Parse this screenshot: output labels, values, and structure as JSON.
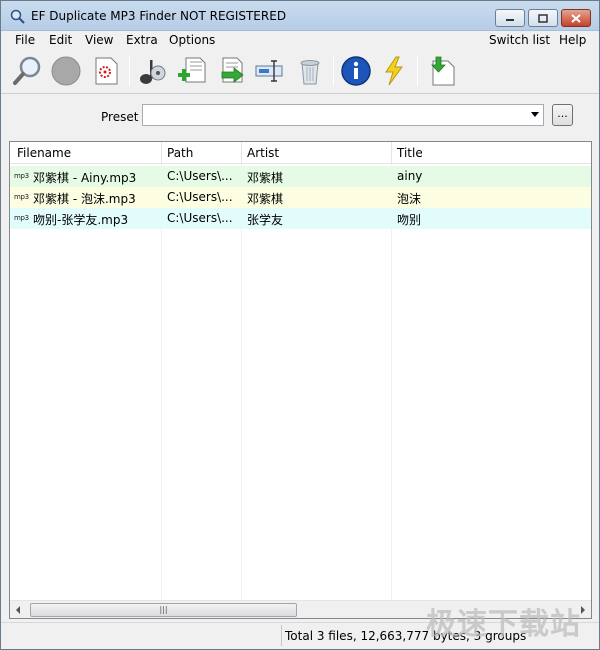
{
  "window": {
    "title": "EF Duplicate MP3 Finder NOT REGISTERED"
  },
  "menu": {
    "items": [
      "File",
      "Edit",
      "View",
      "Extra",
      "Options"
    ],
    "right_items": [
      "Switch list",
      "Help"
    ]
  },
  "toolbar": {
    "buttons": [
      "search-icon",
      "stop-icon",
      "new-document-icon",
      "music-icon",
      "add-files-icon",
      "move-files-icon",
      "rename-icon",
      "recycle-bin-icon",
      "info-icon",
      "lightning-icon",
      "download-icon"
    ]
  },
  "preset": {
    "label": "Preset",
    "value": "",
    "browse_label": "..."
  },
  "list": {
    "columns": [
      "Filename",
      "Path",
      "Artist",
      "Title"
    ],
    "rows": [
      {
        "icon_text": "mp3",
        "filename": "邓紫棋 - Ainy.mp3",
        "path": "C:\\Users\\...",
        "artist": "邓紫棋",
        "title": "ainy",
        "color": "#e6fbe6"
      },
      {
        "icon_text": "mp3",
        "filename": "邓紫棋 - 泡沫.mp3",
        "path": "C:\\Users\\...",
        "artist": "邓紫棋",
        "title": "泡沫",
        "color": "#fdfde2"
      },
      {
        "icon_text": "mp3",
        "filename": "吻别-张学友.mp3",
        "path": "C:\\Users\\...",
        "artist": "张学友",
        "title": "吻别",
        "color": "#e2fbfb"
      }
    ]
  },
  "status": {
    "text": "Total 3 files, 12,663,777 bytes, 3 groups"
  },
  "watermark": "极速下载站"
}
